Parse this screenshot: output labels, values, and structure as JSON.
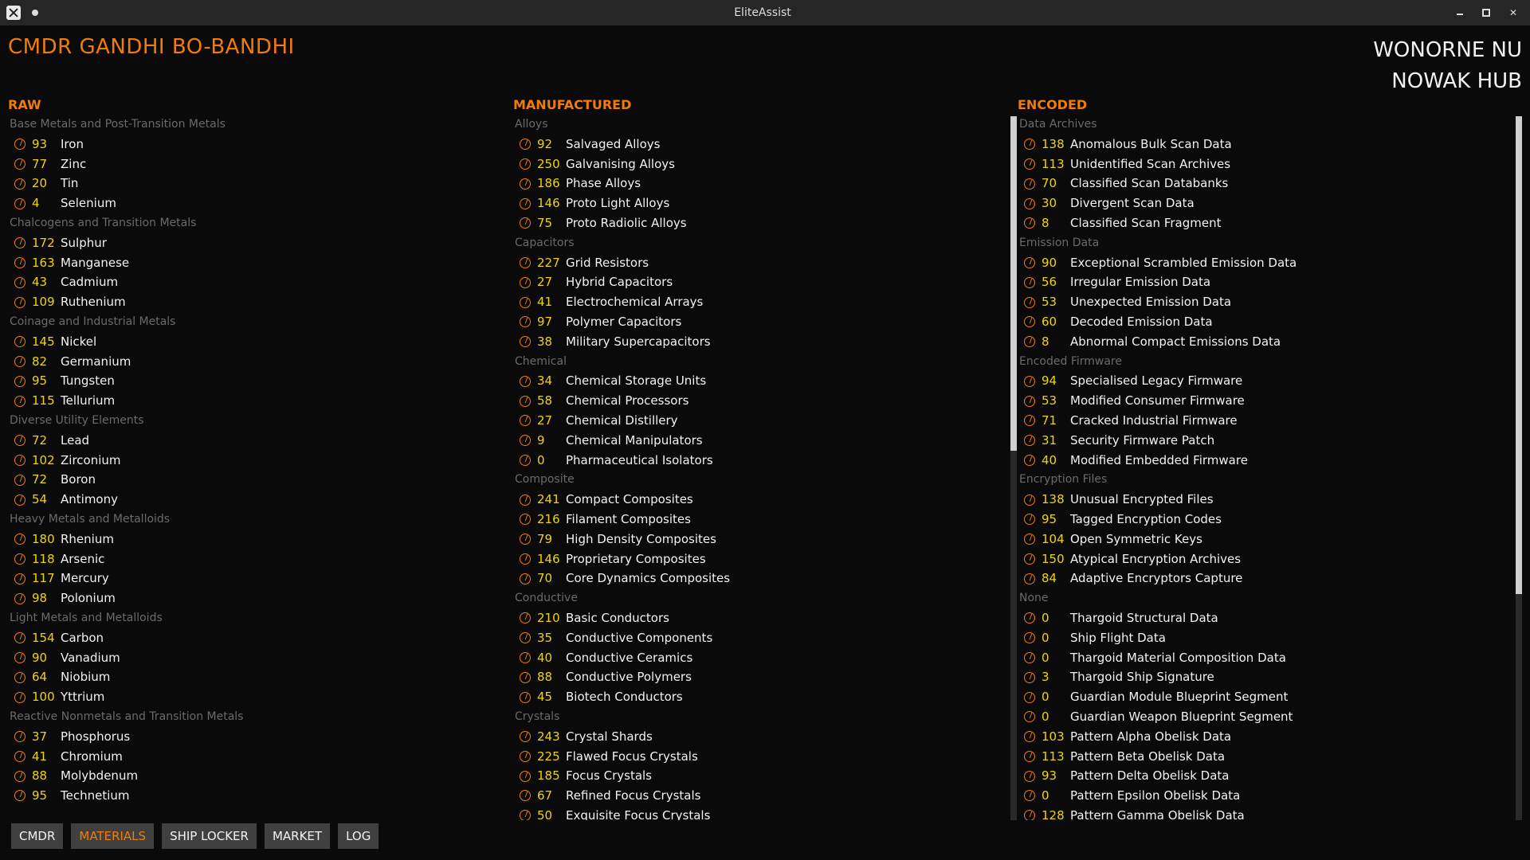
{
  "window": {
    "title": "EliteAssist"
  },
  "cmdr": {
    "name": "CMDR GANDHI BO-BANDHI"
  },
  "location": {
    "system": "WONORNE NU",
    "station": "NOWAK HUB"
  },
  "columns": [
    {
      "title": "RAW",
      "groups": [
        {
          "label": "Base Metals and Post-Transition Metals",
          "items": [
            {
              "count": "93",
              "name": "Iron"
            },
            {
              "count": "77",
              "name": "Zinc"
            },
            {
              "count": "20",
              "name": "Tin"
            },
            {
              "count": "4",
              "name": "Selenium"
            }
          ]
        },
        {
          "label": "Chalcogens and Transition Metals",
          "items": [
            {
              "count": "172",
              "name": "Sulphur"
            },
            {
              "count": "163",
              "name": "Manganese"
            },
            {
              "count": "43",
              "name": "Cadmium"
            },
            {
              "count": "109",
              "name": "Ruthenium"
            }
          ]
        },
        {
          "label": "Coinage and Industrial Metals",
          "items": [
            {
              "count": "145",
              "name": "Nickel"
            },
            {
              "count": "82",
              "name": "Germanium"
            },
            {
              "count": "95",
              "name": "Tungsten"
            },
            {
              "count": "115",
              "name": "Tellurium"
            }
          ]
        },
        {
          "label": "Diverse Utility Elements",
          "items": [
            {
              "count": "72",
              "name": "Lead"
            },
            {
              "count": "102",
              "name": "Zirconium"
            },
            {
              "count": "72",
              "name": "Boron"
            },
            {
              "count": "54",
              "name": "Antimony"
            }
          ]
        },
        {
          "label": "Heavy Metals and Metalloids",
          "items": [
            {
              "count": "180",
              "name": "Rhenium"
            },
            {
              "count": "118",
              "name": "Arsenic"
            },
            {
              "count": "117",
              "name": "Mercury"
            },
            {
              "count": "98",
              "name": "Polonium"
            }
          ]
        },
        {
          "label": "Light Metals and Metalloids",
          "items": [
            {
              "count": "154",
              "name": "Carbon"
            },
            {
              "count": "90",
              "name": "Vanadium"
            },
            {
              "count": "64",
              "name": "Niobium"
            },
            {
              "count": "100",
              "name": "Yttrium"
            }
          ]
        },
        {
          "label": "Reactive Nonmetals and Transition Metals",
          "items": [
            {
              "count": "37",
              "name": "Phosphorus"
            },
            {
              "count": "41",
              "name": "Chromium"
            },
            {
              "count": "88",
              "name": "Molybdenum"
            },
            {
              "count": "95",
              "name": "Technetium"
            }
          ]
        }
      ]
    },
    {
      "title": "MANUFACTURED",
      "groups": [
        {
          "label": "Alloys",
          "items": [
            {
              "count": "92",
              "name": "Salvaged Alloys"
            },
            {
              "count": "250",
              "name": "Galvanising Alloys"
            },
            {
              "count": "186",
              "name": "Phase Alloys"
            },
            {
              "count": "146",
              "name": "Proto Light Alloys"
            },
            {
              "count": "75",
              "name": "Proto Radiolic Alloys"
            }
          ]
        },
        {
          "label": "Capacitors",
          "items": [
            {
              "count": "227",
              "name": "Grid Resistors"
            },
            {
              "count": "27",
              "name": "Hybrid Capacitors"
            },
            {
              "count": "41",
              "name": "Electrochemical Arrays"
            },
            {
              "count": "97",
              "name": "Polymer Capacitors"
            },
            {
              "count": "38",
              "name": "Military Supercapacitors"
            }
          ]
        },
        {
          "label": "Chemical",
          "items": [
            {
              "count": "34",
              "name": "Chemical Storage Units"
            },
            {
              "count": "58",
              "name": "Chemical Processors"
            },
            {
              "count": "27",
              "name": "Chemical Distillery"
            },
            {
              "count": "9",
              "name": "Chemical Manipulators"
            },
            {
              "count": "0",
              "name": "Pharmaceutical Isolators"
            }
          ]
        },
        {
          "label": "Composite",
          "items": [
            {
              "count": "241",
              "name": "Compact Composites"
            },
            {
              "count": "216",
              "name": "Filament Composites"
            },
            {
              "count": "79",
              "name": "High Density Composites"
            },
            {
              "count": "146",
              "name": "Proprietary Composites"
            },
            {
              "count": "70",
              "name": "Core Dynamics Composites"
            }
          ]
        },
        {
          "label": "Conductive",
          "items": [
            {
              "count": "210",
              "name": "Basic Conductors"
            },
            {
              "count": "35",
              "name": "Conductive Components"
            },
            {
              "count": "40",
              "name": "Conductive Ceramics"
            },
            {
              "count": "88",
              "name": "Conductive Polymers"
            },
            {
              "count": "45",
              "name": "Biotech Conductors"
            }
          ]
        },
        {
          "label": "Crystals",
          "items": [
            {
              "count": "243",
              "name": "Crystal Shards"
            },
            {
              "count": "225",
              "name": "Flawed Focus Crystals"
            },
            {
              "count": "185",
              "name": "Focus Crystals"
            },
            {
              "count": "67",
              "name": "Refined Focus Crystals"
            },
            {
              "count": "50",
              "name": "Exquisite Focus Crystals"
            }
          ]
        }
      ]
    },
    {
      "title": "ENCODED",
      "groups": [
        {
          "label": "Data Archives",
          "items": [
            {
              "count": "138",
              "name": "Anomalous Bulk Scan Data"
            },
            {
              "count": "113",
              "name": "Unidentified Scan Archives"
            },
            {
              "count": "70",
              "name": "Classified Scan Databanks"
            },
            {
              "count": "30",
              "name": "Divergent Scan Data"
            },
            {
              "count": "8",
              "name": "Classified Scan Fragment"
            }
          ]
        },
        {
          "label": "Emission Data",
          "items": [
            {
              "count": "90",
              "name": "Exceptional Scrambled Emission Data"
            },
            {
              "count": "56",
              "name": "Irregular Emission Data"
            },
            {
              "count": "53",
              "name": "Unexpected Emission Data"
            },
            {
              "count": "60",
              "name": "Decoded Emission Data"
            },
            {
              "count": "8",
              "name": "Abnormal Compact Emissions Data"
            }
          ]
        },
        {
          "label": "Encoded Firmware",
          "items": [
            {
              "count": "94",
              "name": "Specialised Legacy Firmware"
            },
            {
              "count": "53",
              "name": "Modified Consumer Firmware"
            },
            {
              "count": "71",
              "name": "Cracked Industrial Firmware"
            },
            {
              "count": "31",
              "name": "Security Firmware Patch"
            },
            {
              "count": "40",
              "name": "Modified Embedded Firmware"
            }
          ]
        },
        {
          "label": "Encryption Files",
          "items": [
            {
              "count": "138",
              "name": "Unusual Encrypted Files"
            },
            {
              "count": "95",
              "name": "Tagged Encryption Codes"
            },
            {
              "count": "104",
              "name": "Open Symmetric Keys"
            },
            {
              "count": "150",
              "name": "Atypical Encryption Archives"
            },
            {
              "count": "84",
              "name": "Adaptive Encryptors Capture"
            }
          ]
        },
        {
          "label": "None",
          "items": [
            {
              "count": "0",
              "name": "Thargoid Structural Data"
            },
            {
              "count": "0",
              "name": "Ship Flight Data"
            },
            {
              "count": "0",
              "name": "Thargoid Material Composition Data"
            },
            {
              "count": "3",
              "name": "Thargoid Ship Signature"
            },
            {
              "count": "0",
              "name": "Guardian Module Blueprint Segment"
            },
            {
              "count": "0",
              "name": "Guardian Weapon Blueprint Segment"
            },
            {
              "count": "103",
              "name": "Pattern Alpha Obelisk Data"
            },
            {
              "count": "113",
              "name": "Pattern Beta Obelisk Data"
            },
            {
              "count": "93",
              "name": "Pattern Delta Obelisk Data"
            },
            {
              "count": "0",
              "name": "Pattern Epsilon Obelisk Data"
            },
            {
              "count": "128",
              "name": "Pattern Gamma Obelisk Data"
            }
          ]
        }
      ]
    }
  ],
  "tabs": [
    {
      "label": "CMDR",
      "active": false
    },
    {
      "label": "MATERIALS",
      "active": true
    },
    {
      "label": "SHIP LOCKER",
      "active": false
    },
    {
      "label": "MARKET",
      "active": false
    },
    {
      "label": "LOG",
      "active": false
    }
  ],
  "colors": {
    "accent": "#f07b05",
    "count": "#f0d400",
    "group_label": "#6a6a6a"
  },
  "icons": {
    "grade": "material-grade-icon"
  }
}
